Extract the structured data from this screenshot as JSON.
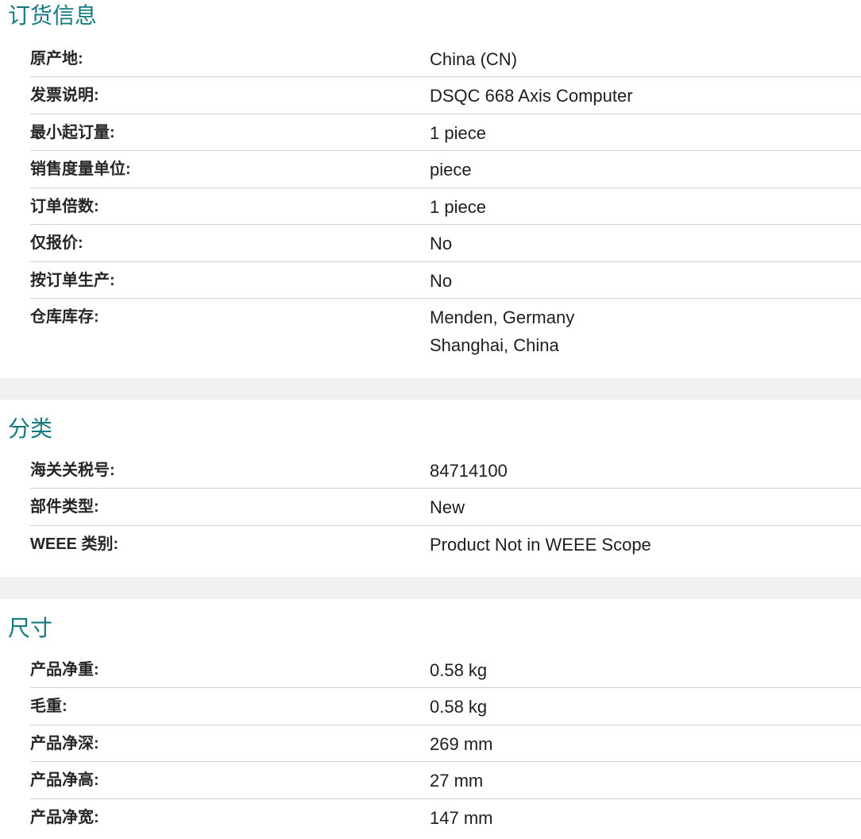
{
  "colors": {
    "accent": "#157a80",
    "label": "#262626",
    "value": "#1e1e1e",
    "rule": "#d3d3d3",
    "band": "#f0f0f0"
  },
  "sections": [
    {
      "title": "订货信息",
      "rows": [
        {
          "label": "原产地:",
          "value": "China (CN)"
        },
        {
          "label": "发票说明:",
          "value": "DSQC 668 Axis Computer"
        },
        {
          "label": "最小起订量:",
          "value": "1 piece"
        },
        {
          "label": "销售度量单位:",
          "value": "piece"
        },
        {
          "label": "订单倍数:",
          "value": "1 piece"
        },
        {
          "label": "仅报价:",
          "value": "No"
        },
        {
          "label": "按订单生产:",
          "value": "No"
        },
        {
          "label": "仓库库存:",
          "values": [
            "Menden, Germany",
            "Shanghai, China"
          ]
        }
      ]
    },
    {
      "title": "分类",
      "rows": [
        {
          "label": "海关关税号:",
          "value": "84714100"
        },
        {
          "label": "部件类型:",
          "value": "New"
        },
        {
          "label": "WEEE 类别:",
          "value": "Product Not in WEEE Scope"
        }
      ]
    },
    {
      "title": "尺寸",
      "rows": [
        {
          "label": "产品净重:",
          "value": "0.58 kg"
        },
        {
          "label": "毛重:",
          "value": "0.58 kg"
        },
        {
          "label": "产品净深:",
          "value": "269 mm"
        },
        {
          "label": "产品净高:",
          "value": "27 mm"
        },
        {
          "label": "产品净宽:",
          "value": "147 mm"
        }
      ]
    }
  ]
}
